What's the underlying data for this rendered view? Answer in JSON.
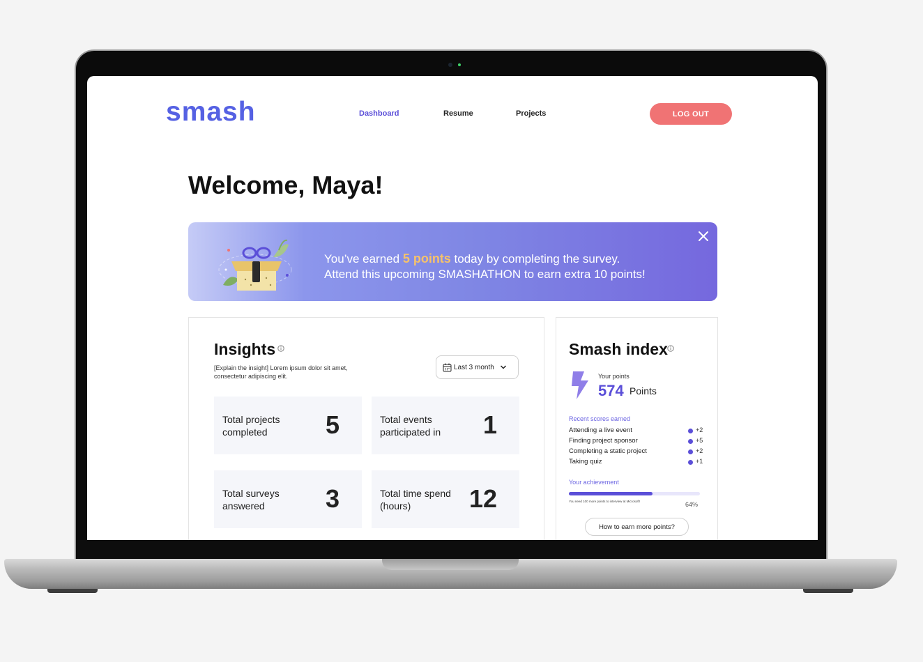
{
  "app": {
    "logo": "smash"
  },
  "nav": {
    "items": [
      {
        "label": "Dashboard",
        "active": true
      },
      {
        "label": "Resume",
        "active": false
      },
      {
        "label": "Projects",
        "active": false
      }
    ],
    "logout_label": "LOG OUT"
  },
  "welcome": "Welcome, Maya!",
  "banner": {
    "line1_before": "You’ve earned ",
    "line1_points": "5 points",
    "line1_after": " today by completing the survey.",
    "line2": "Attend this upcoming SMASHATHON to earn extra 10 points!",
    "close_icon": "close-icon"
  },
  "insights": {
    "title": "Insights",
    "description": "[Explain the insight] Lorem ipsum dolor sit amet, consectetur adipiscing elit.",
    "date_range": "Last 3 month",
    "stats": [
      {
        "label": "Total projects completed",
        "value": "5"
      },
      {
        "label": "Total events participated in",
        "value": "1"
      },
      {
        "label": "Total surveys answered",
        "value": "3"
      },
      {
        "label": "Total time spend (hours)",
        "value": "12"
      }
    ]
  },
  "smash_index": {
    "title": "Smash index",
    "points_caption": "Your points",
    "points_value": "574",
    "points_unit": "Points",
    "recent_label": "Recent scores earned",
    "recent": [
      {
        "label": "Attending a live event",
        "score": "+2"
      },
      {
        "label": "Finding project sponsor",
        "score": "+5"
      },
      {
        "label": "Completing a static project",
        "score": "+2"
      },
      {
        "label": "Taking quiz",
        "score": "+1"
      }
    ],
    "achievement_label": "Your achievement",
    "achievement_note": "You need 100 more points to interview at Microsoft!",
    "achievement_percent_text": "64%",
    "achievement_fraction": 0.64,
    "earn_button": "How to earn more points?"
  },
  "colors": {
    "brand": "#5561e3",
    "accent": "#5b4fd8",
    "logout": "#f07374",
    "points_highlight": "#f6c26b"
  }
}
